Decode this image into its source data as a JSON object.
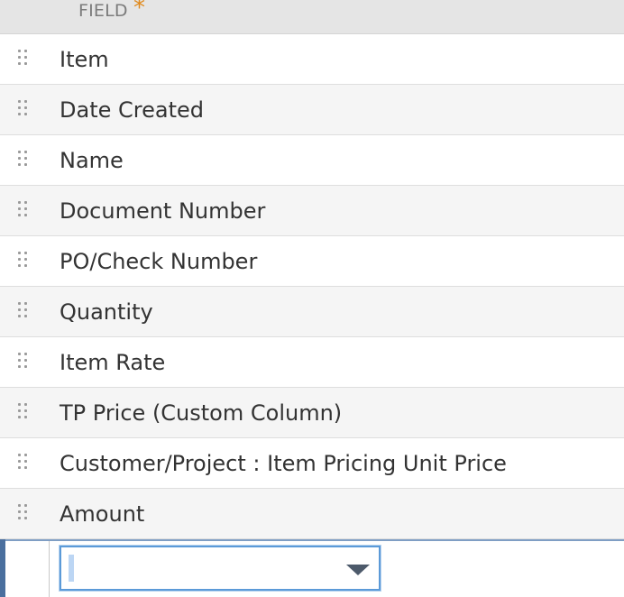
{
  "header": {
    "field_label": "FIELD",
    "required_mark": "*"
  },
  "rows": [
    {
      "label": "Item"
    },
    {
      "label": "Date Created"
    },
    {
      "label": "Name"
    },
    {
      "label": "Document Number"
    },
    {
      "label": "PO/Check Number"
    },
    {
      "label": "Quantity"
    },
    {
      "label": "Item Rate"
    },
    {
      "label": "TP Price (Custom Column)"
    },
    {
      "label": "Customer/Project : Item Pricing Unit Price"
    },
    {
      "label": "Amount"
    }
  ],
  "new_row": {
    "field_select_value": ""
  },
  "colors": {
    "required_star": "#e08a1e",
    "select_focus_border": "#5b9ad8",
    "active_row_marker": "#4a6f9e"
  }
}
